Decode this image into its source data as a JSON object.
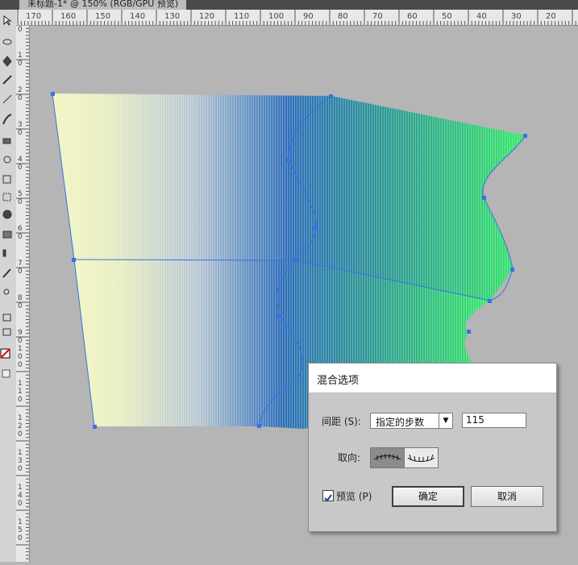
{
  "document_tab": {
    "title": "未标题-1* @ 150% (RGB/GPU 预览)"
  },
  "rulers": {
    "horizontal_labels": [
      "170",
      "160",
      "150",
      "140",
      "130",
      "120",
      "110",
      "100",
      "90",
      "80",
      "70",
      "60",
      "50",
      "40",
      "30",
      "20"
    ],
    "vertical_labels": [
      "0",
      "10",
      "20",
      "30",
      "40",
      "50",
      "60",
      "70",
      "80",
      "90",
      "100",
      "110",
      "120",
      "130",
      "140",
      "150"
    ]
  },
  "toolbar": {
    "tools": [
      "direct-select-tool",
      "lasso-tool",
      "pen-tool",
      "pencil-tool",
      "line-tool",
      "brush-tool",
      "eraser-tool",
      "rotate-tool",
      "scale-tool",
      "free-transform-tool",
      "blob-brush-tool",
      "rectangle-tool",
      "ellipse-tool",
      "graph-tool",
      "mesh-tool",
      "eyedropper-tool",
      "zoom-tool",
      "fill-stroke-swatch",
      "draw-mode"
    ]
  },
  "colors": {
    "gradient_start": "#f2f6c0",
    "gradient_mid": "#2f6fb8",
    "gradient_end": "#39e86a",
    "path": "#3a6fe6"
  },
  "dialog": {
    "title": "混合选项",
    "spacing_label": "间距 (S):",
    "spacing_value": "指定的步数",
    "steps_value": "115",
    "orientation_label": "取向:",
    "orientation_options": [
      "align-to-page-icon",
      "align-to-path-icon"
    ],
    "preview_label": "预览 (P)",
    "preview_checked": true,
    "ok_label": "确定",
    "cancel_label": "取消"
  }
}
